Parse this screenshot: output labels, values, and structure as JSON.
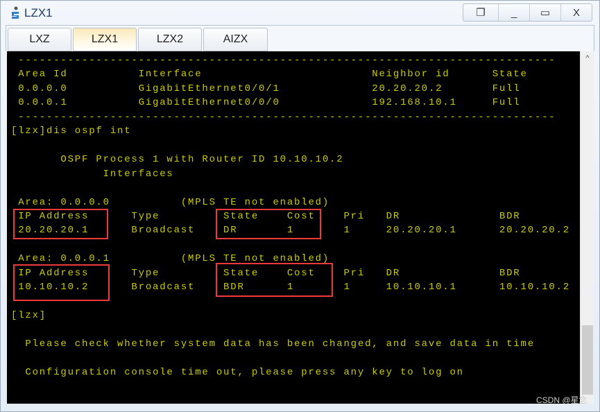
{
  "window": {
    "title": "LZX1",
    "controls": {
      "restore": "❐",
      "minimize": "_",
      "maximize": "▭",
      "close": "X"
    }
  },
  "tabs": [
    {
      "label": "LXZ"
    },
    {
      "label": "LZX1",
      "active": true
    },
    {
      "label": "LZX2"
    },
    {
      "label": "AIZX"
    }
  ],
  "terminal": {
    "text_color": "#cccc00",
    "highlight_color": "#ef3a3a",
    "lines": [
      " ----------------------------------------------------------------------------",
      " Area Id          Interface                        Neighbor id      State",
      " 0.0.0.0          GigabitEthernet0/0/1             20.20.20.2       Full",
      " 0.0.0.1          GigabitEthernet0/0/0             192.168.10.1     Full",
      " ----------------------------------------------------------------------------",
      "[lzx]dis ospf int",
      "",
      "       OSPF Process 1 with Router ID 10.10.10.2",
      "             Interfaces",
      "",
      " Area: 0.0.0.0          (MPLS TE not enabled)",
      " IP Address      Type         State    Cost    Pri   DR              BDR",
      " 20.20.20.1      Broadcast    DR       1       1     20.20.20.1      20.20.20.2",
      "",
      " Area: 0.0.0.1          (MPLS TE not enabled)",
      " IP Address      Type         State    Cost    Pri   DR              BDR",
      " 10.10.10.2      Broadcast    BDR      1       1     10.10.10.1      10.10.10.2",
      "",
      "[lzx]",
      "",
      "  Please check whether system data has been changed, and save data in time",
      "",
      "  Configuration console time out, please press any key to log on"
    ]
  },
  "watermark": "CSDN @星念"
}
